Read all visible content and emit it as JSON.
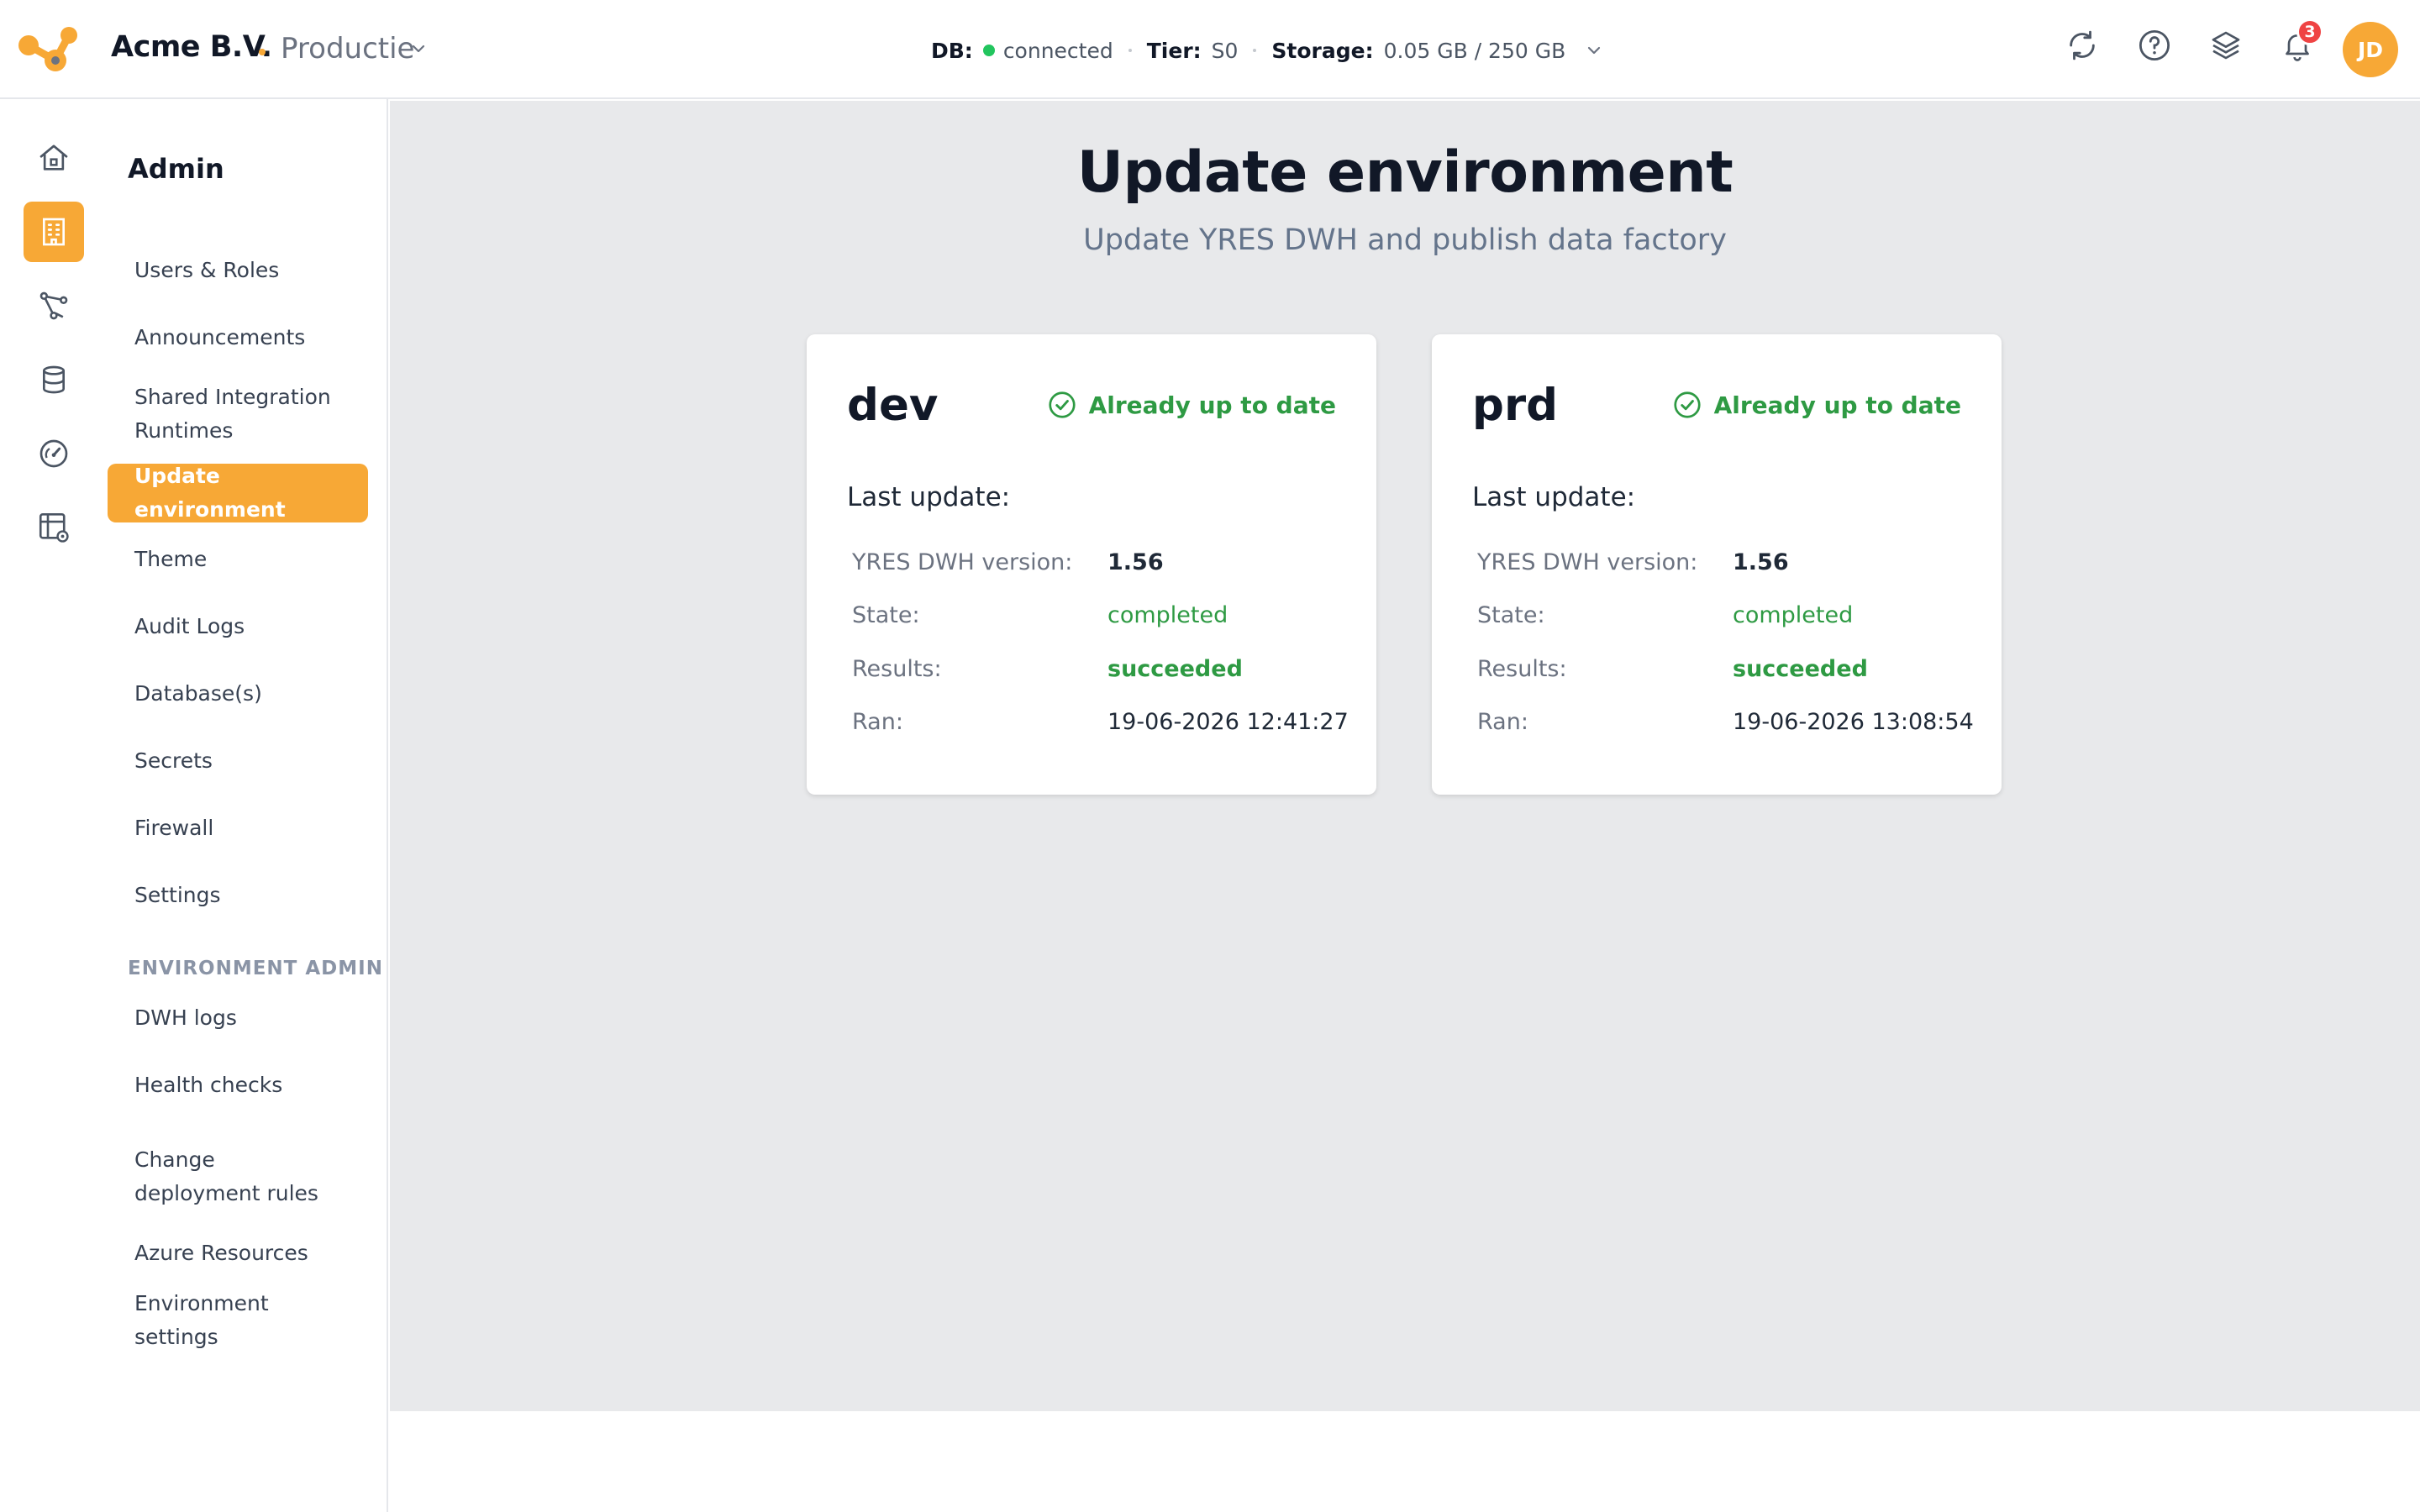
{
  "header": {
    "org_name": "Acme B.V.",
    "environment": "Productie",
    "status": {
      "db_label": "DB:",
      "db_value": "connected",
      "tier_label": "Tier:",
      "tier_value": "S0",
      "storage_label": "Storage:",
      "storage_value": "0.05 GB / 250 GB"
    },
    "notification_count": "3",
    "avatar_initials": "JD",
    "icons": [
      "refresh-icon",
      "help-icon",
      "layers-icon",
      "bell-icon"
    ]
  },
  "rail": {
    "items": [
      "home-icon",
      "building-icon",
      "pipeline-icon",
      "database-icon",
      "gauge-icon",
      "table-settings-icon"
    ],
    "active": "building-icon"
  },
  "subnav": {
    "title": "Admin",
    "items": [
      {
        "label": "Users & Roles"
      },
      {
        "label": "Announcements"
      },
      {
        "label": "Shared Integration Runtimes"
      },
      {
        "label": "Update environment",
        "active": true
      },
      {
        "label": "Theme"
      },
      {
        "label": "Audit Logs"
      },
      {
        "label": "Database(s)"
      },
      {
        "label": "Secrets"
      },
      {
        "label": "Firewall"
      },
      {
        "label": "Settings"
      }
    ],
    "section_label": "ENVIRONMENT ADMIN",
    "section_items": [
      {
        "label": "DWH logs"
      },
      {
        "label": "Health checks"
      },
      {
        "label": "Change deployment rules"
      },
      {
        "label": "Azure Resources"
      },
      {
        "label": "Environment settings"
      }
    ]
  },
  "main": {
    "title": "Update environment",
    "subtitle": "Update YRES DWH and publish data factory",
    "cards": [
      {
        "name": "dev",
        "status": "Already up to date",
        "last_update_label": "Last update:",
        "version_label": "YRES DWH version:",
        "version": "1.56",
        "state_label": "State:",
        "state": "completed",
        "results_label": "Results:",
        "results": "succeeded",
        "ran_label": "Ran:",
        "ran": "19-06-2026 12:41:27"
      },
      {
        "name": "prd",
        "status": "Already up to date",
        "last_update_label": "Last update:",
        "version_label": "YRES DWH version:",
        "version": "1.56",
        "state_label": "State:",
        "state": "completed",
        "results_label": "Results:",
        "results": "succeeded",
        "ran_label": "Ran:",
        "ran": "19-06-2026 13:08:54"
      }
    ]
  },
  "colors": {
    "accent": "#f7a836",
    "success": "#2e9a43",
    "badge": "#ef4444",
    "connected": "#22c55e"
  }
}
